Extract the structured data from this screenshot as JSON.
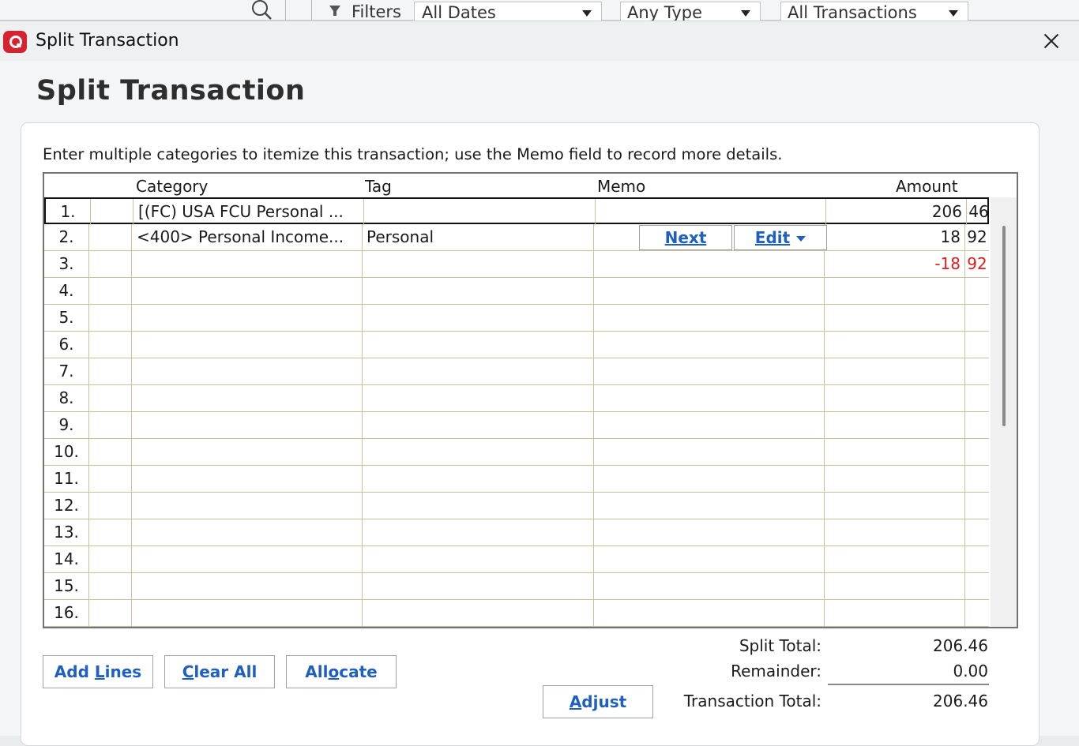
{
  "background_toolbar": {
    "filters_label": "Filters",
    "dates_value": "All Dates",
    "type_value": "Any Type",
    "transactions_value": "All Transactions"
  },
  "window": {
    "title": "Split Transaction",
    "heading": "Split Transaction",
    "instructions": "Enter multiple categories to itemize this transaction; use the Memo field to record more details."
  },
  "grid": {
    "headers": {
      "category": "Category",
      "tag": "Tag",
      "memo": "Memo",
      "amount": "Amount"
    },
    "rows": [
      {
        "num": "1.",
        "category": "[(FC) USA FCU Personal ...",
        "tag": "",
        "memo": "",
        "dollars": "206",
        "cents": "46"
      },
      {
        "num": "2.",
        "category": "<400> Personal Income...",
        "tag": "Personal",
        "memo": "",
        "dollars": "18",
        "cents": "92"
      },
      {
        "num": "3.",
        "category": "",
        "tag": "",
        "memo": "",
        "dollars": "-18",
        "cents": "92"
      },
      {
        "num": "4.",
        "category": "",
        "tag": "",
        "memo": "",
        "dollars": "",
        "cents": ""
      },
      {
        "num": "5.",
        "category": "",
        "tag": "",
        "memo": "",
        "dollars": "",
        "cents": ""
      },
      {
        "num": "6.",
        "category": "",
        "tag": "",
        "memo": "",
        "dollars": "",
        "cents": ""
      },
      {
        "num": "7.",
        "category": "",
        "tag": "",
        "memo": "",
        "dollars": "",
        "cents": ""
      },
      {
        "num": "8.",
        "category": "",
        "tag": "",
        "memo": "",
        "dollars": "",
        "cents": ""
      },
      {
        "num": "9.",
        "category": "",
        "tag": "",
        "memo": "",
        "dollars": "",
        "cents": ""
      },
      {
        "num": "10.",
        "category": "",
        "tag": "",
        "memo": "",
        "dollars": "",
        "cents": ""
      },
      {
        "num": "11.",
        "category": "",
        "tag": "",
        "memo": "",
        "dollars": "",
        "cents": ""
      },
      {
        "num": "12.",
        "category": "",
        "tag": "",
        "memo": "",
        "dollars": "",
        "cents": ""
      },
      {
        "num": "13.",
        "category": "",
        "tag": "",
        "memo": "",
        "dollars": "",
        "cents": ""
      },
      {
        "num": "14.",
        "category": "",
        "tag": "",
        "memo": "",
        "dollars": "",
        "cents": ""
      },
      {
        "num": "15.",
        "category": "",
        "tag": "",
        "memo": "",
        "dollars": "",
        "cents": ""
      },
      {
        "num": "16.",
        "category": "",
        "tag": "",
        "memo": "",
        "dollars": "",
        "cents": ""
      }
    ],
    "row_buttons": {
      "next_label": "Next",
      "edit_label": "Edit"
    }
  },
  "buttons": {
    "add_lines": {
      "before": "Add ",
      "mnemonic": "L",
      "after": "ines"
    },
    "clear_all": {
      "before": "",
      "mnemonic": "C",
      "after": "lear All"
    },
    "allocate": {
      "before": "All",
      "mnemonic": "o",
      "after": "cate"
    },
    "adjust": {
      "before": "",
      "mnemonic": "A",
      "after": "djust"
    }
  },
  "totals": {
    "split_total_label": "Split Total:",
    "split_total_value": "206.46",
    "remainder_label": "Remainder:",
    "remainder_value": "0.00",
    "transaction_total_label": "Transaction Total:",
    "transaction_total_value": "206.46"
  },
  "colors": {
    "link_blue": "#1f5fbf",
    "negative_red": "#e21b1b",
    "grid_line": "#c9c29d",
    "brand_red": "#d6232f"
  },
  "icons": {
    "search": "search-icon",
    "filter": "funnel-icon",
    "close": "close-icon",
    "app": "quicken-logo-icon"
  }
}
